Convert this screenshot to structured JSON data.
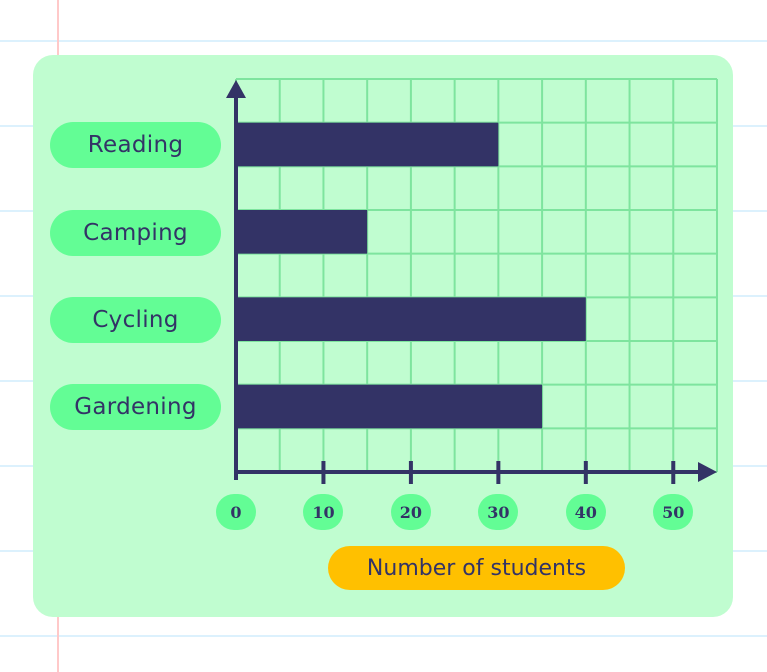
{
  "chart_data": {
    "type": "bar",
    "orientation": "horizontal",
    "title": "",
    "categories": [
      "Reading",
      "Camping",
      "Cycling",
      "Gardening"
    ],
    "values": [
      30,
      15,
      40,
      35
    ],
    "xlabel": "Number of students",
    "ylabel": "",
    "xlim": [
      0,
      55
    ],
    "xticks": [
      "0",
      "10",
      "20",
      "30",
      "40",
      "50"
    ],
    "grid": true,
    "colors": {
      "bar": "#333366",
      "grid": "#7ee49e",
      "card_background": "#c0fdd0",
      "label_pill": "#63fd95",
      "axis_label_pill": "#ffc000",
      "axis": "#333366"
    }
  }
}
